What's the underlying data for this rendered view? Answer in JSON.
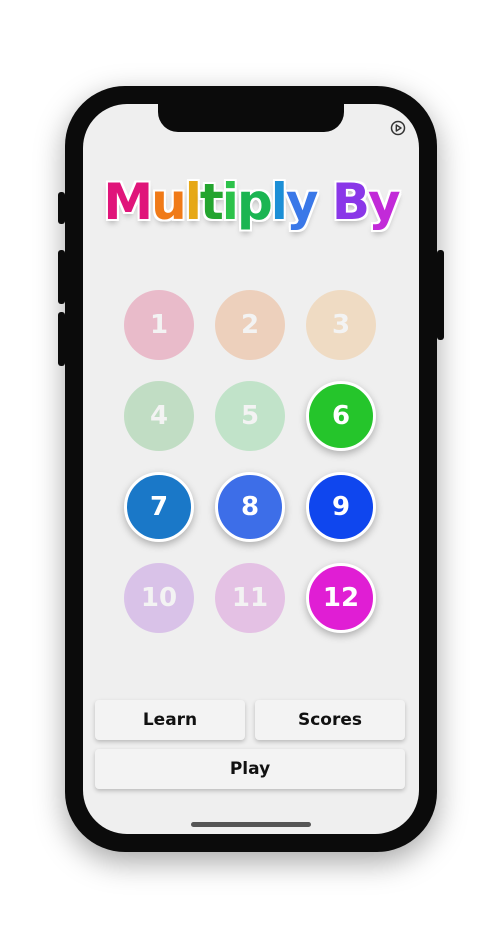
{
  "app": {
    "title_letters": [
      {
        "char": "M",
        "color": "#e0157a"
      },
      {
        "char": "u",
        "color": "#f07a18"
      },
      {
        "char": "l",
        "color": "#e6a817"
      },
      {
        "char": "t",
        "color": "#24a52f"
      },
      {
        "char": "i",
        "color": "#2cc24a"
      },
      {
        "char": "p",
        "color": "#1bb552"
      },
      {
        "char": "l",
        "color": "#1c8fd6"
      },
      {
        "char": "y",
        "color": "#3a78e8"
      },
      {
        "char": " ",
        "color": "#000000"
      },
      {
        "char": "B",
        "color": "#8a37e8"
      },
      {
        "char": "y",
        "color": "#c22ad8"
      }
    ]
  },
  "settings": {
    "icon": "settings-icon"
  },
  "numbers": [
    {
      "label": "1",
      "color": "#d9245e",
      "active": false
    },
    {
      "label": "2",
      "color": "#e8782a",
      "active": false
    },
    {
      "label": "3",
      "color": "#f2a345",
      "active": false
    },
    {
      "label": "4",
      "color": "#3aaa48",
      "active": false
    },
    {
      "label": "5",
      "color": "#3cc25a",
      "active": false
    },
    {
      "label": "6",
      "color": "#25c52b",
      "active": true
    },
    {
      "label": "7",
      "color": "#1a78c8",
      "active": true
    },
    {
      "label": "8",
      "color": "#3d6ee8",
      "active": true
    },
    {
      "label": "9",
      "color": "#0f46ee",
      "active": true
    },
    {
      "label": "10",
      "color": "#9b3fd6",
      "active": false
    },
    {
      "label": "11",
      "color": "#c53ac4",
      "active": false
    },
    {
      "label": "12",
      "color": "#e01ed4",
      "active": true
    }
  ],
  "buttons": {
    "learn": "Learn",
    "scores": "Scores",
    "play": "Play"
  }
}
